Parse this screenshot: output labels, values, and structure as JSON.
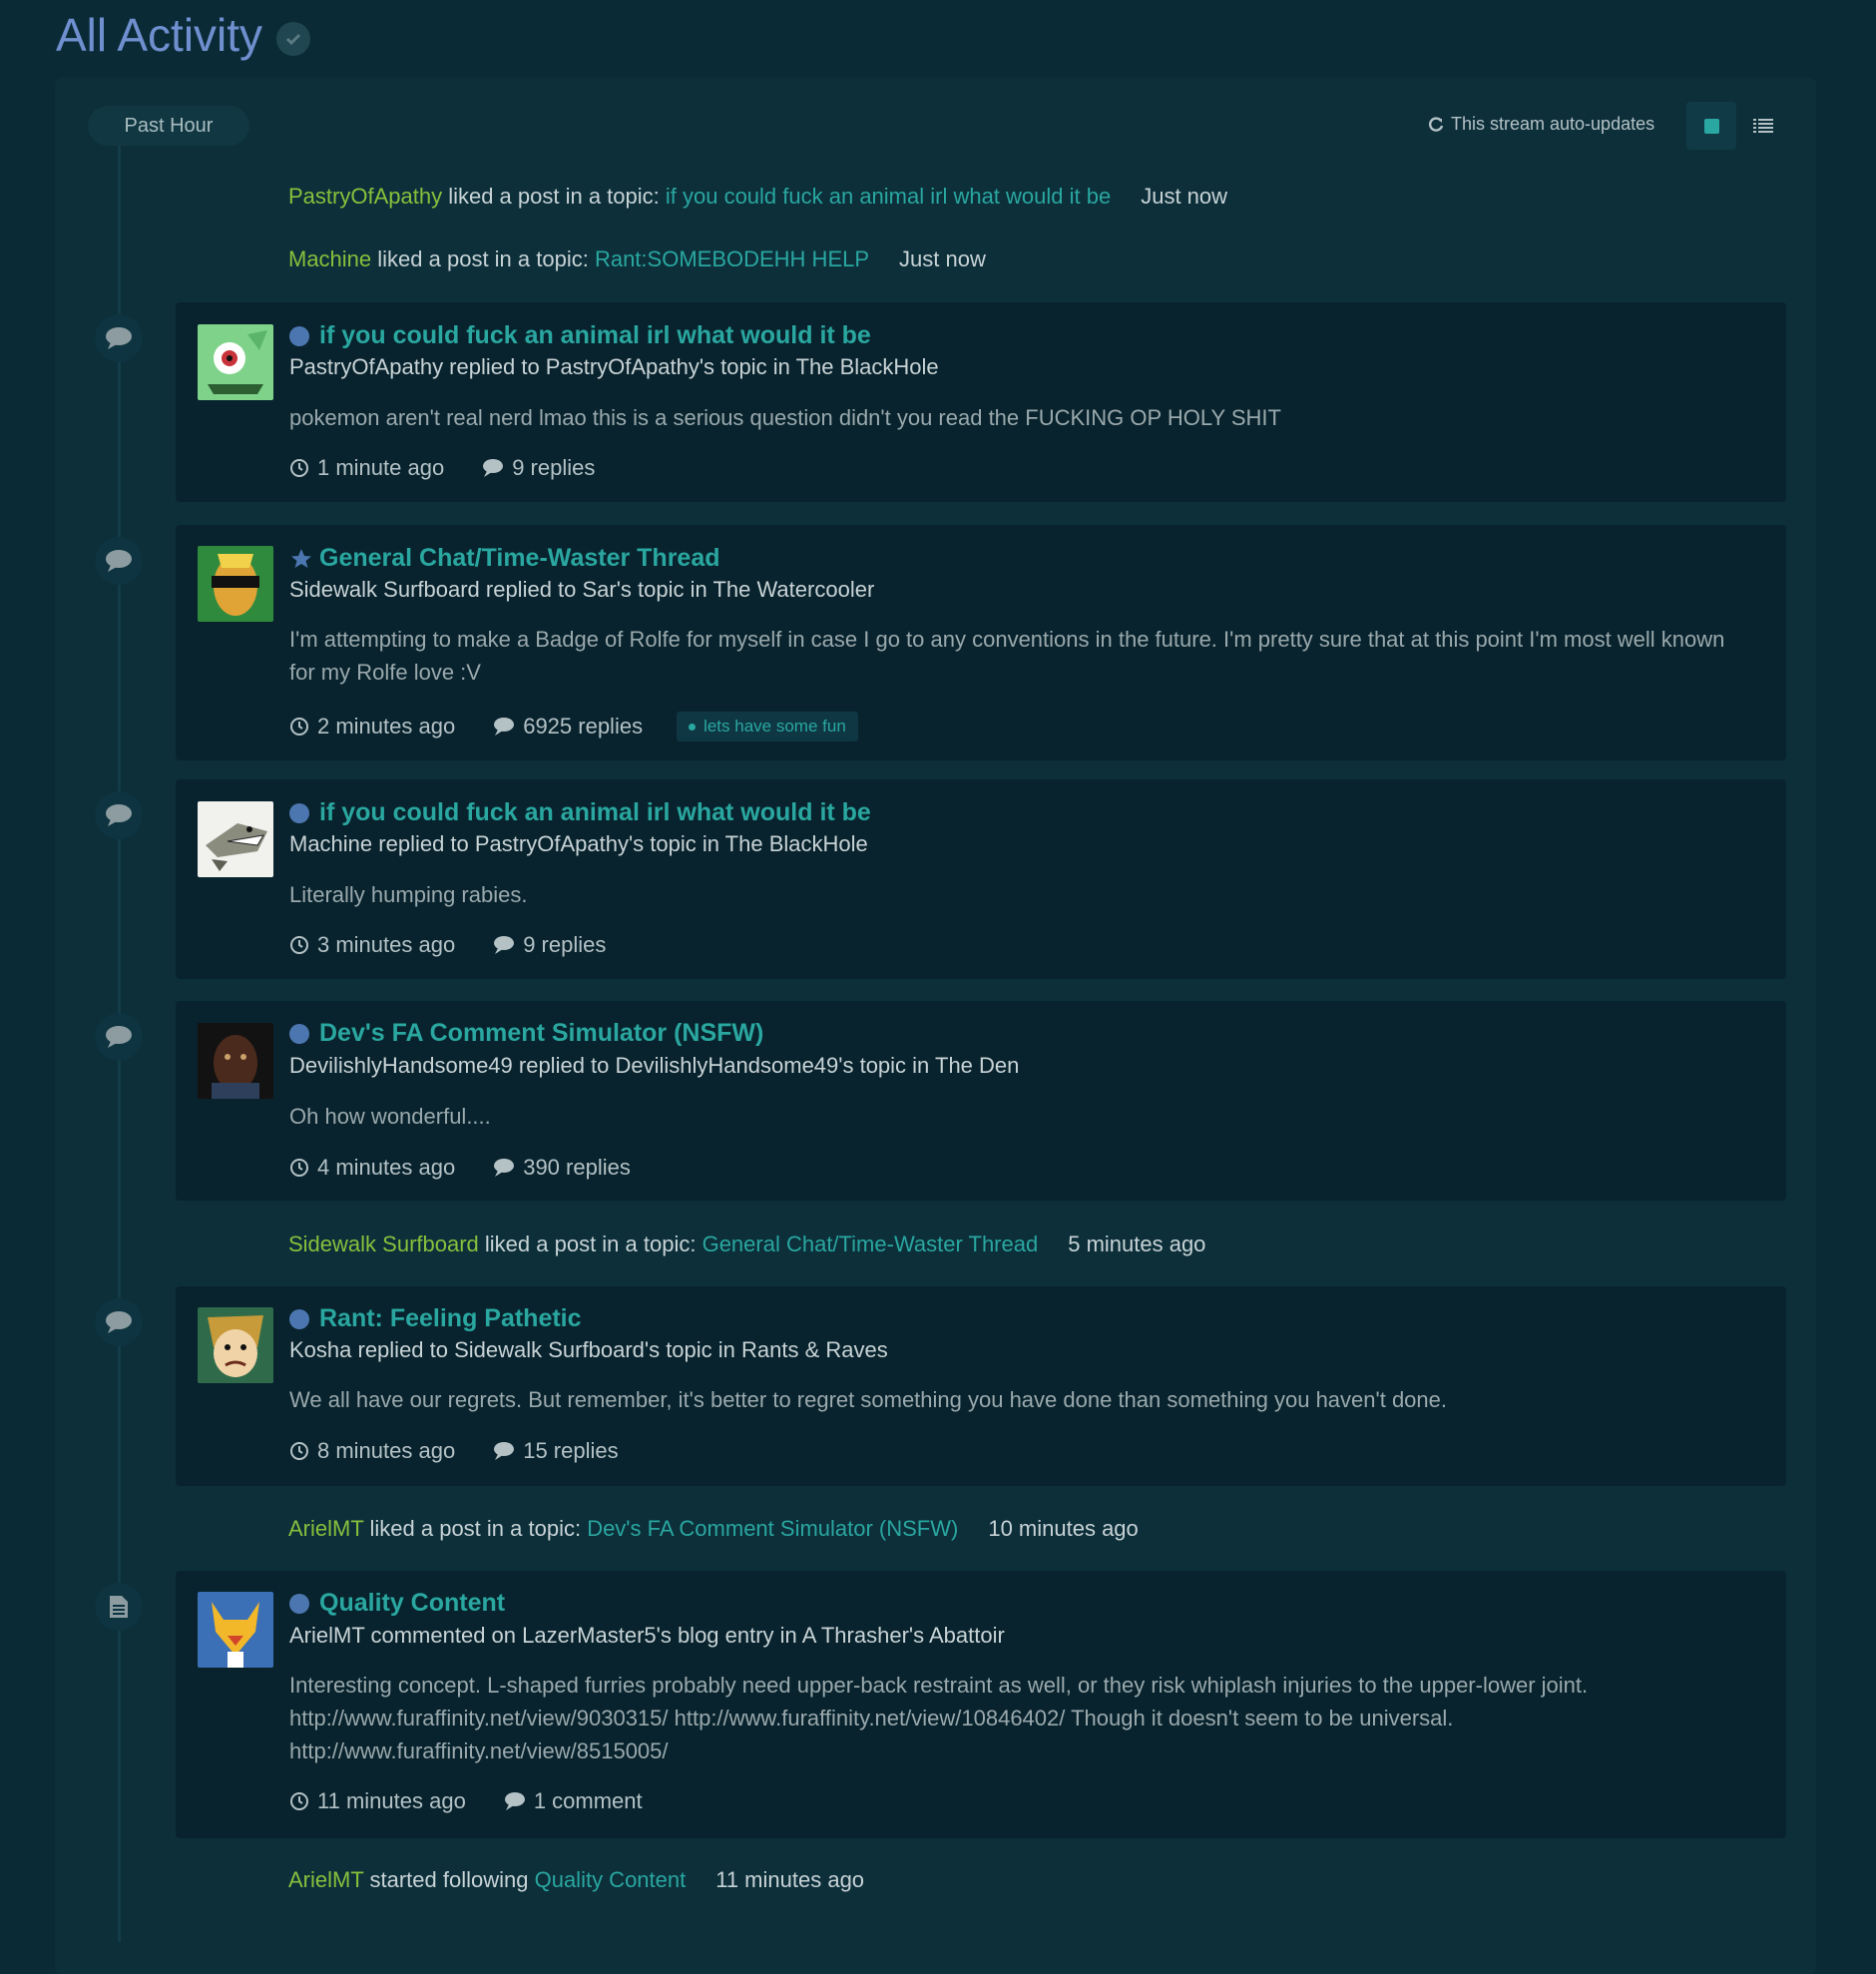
{
  "page": {
    "title": "All Activity"
  },
  "toolbar": {
    "filter_label": "Past Hour",
    "autoupdate_label": "This stream auto-updates",
    "icons": [
      "refresh-icon",
      "expanded-view-icon",
      "condensed-view-icon"
    ]
  },
  "colors": {
    "background": "#0a2b36",
    "accent": "#2aa7a0",
    "username": "#86c13c",
    "title": "#6f8fcf",
    "unread_dot": "#4c76b0"
  },
  "activity": {
    "like1": {
      "user": "PastryOfApathy",
      "action": " liked a post in a topic: ",
      "topic": "if you could fuck an animal irl what would it be",
      "time": "Just now"
    },
    "like2": {
      "user": "Machine",
      "action": " liked a post in a topic: ",
      "topic": "Rant:SOMEBODEHH HELP",
      "time": "Just now"
    },
    "item1": {
      "title": "if you could fuck an animal irl what would it be",
      "subtitle": "PastryOfApathy replied to PastryOfApathy's topic in The BlackHole",
      "snippet": "pokemon aren't real nerd lmao this is a serious question didn't you read the FUCKING OP HOLY SHIT",
      "time": "1 minute ago",
      "replies": "9 replies"
    },
    "item2": {
      "title": "General Chat/Time-Waster Thread",
      "subtitle": "Sidewalk Surfboard replied to Sar's topic in The Watercooler",
      "snippet": "I'm attempting to make a Badge of Rolfe for myself in case I go to any conventions in the future. I'm pretty sure that at this point I'm most well known for my Rolfe love :V",
      "time": "2 minutes ago",
      "replies": "6925 replies",
      "tag": "lets have some fun"
    },
    "item3": {
      "title": "if you could fuck an animal irl what would it be",
      "subtitle": "Machine replied to PastryOfApathy's topic in The BlackHole",
      "snippet": "Literally humping rabies.",
      "time": "3 minutes ago",
      "replies": "9 replies"
    },
    "item4": {
      "title": "Dev's FA Comment Simulator (NSFW)",
      "subtitle": "DevilishlyHandsome49 replied to DevilishlyHandsome49's topic in The Den",
      "snippet": "Oh how wonderful....",
      "time": "4 minutes ago",
      "replies": "390 replies"
    },
    "like3": {
      "user": "Sidewalk Surfboard",
      "action": " liked a post in a topic: ",
      "topic": "General Chat/Time-Waster Thread",
      "time": "5 minutes ago"
    },
    "item5": {
      "title": "Rant: Feeling Pathetic",
      "subtitle": "Kosha replied to Sidewalk Surfboard's topic in Rants & Raves",
      "snippet": "We all have our regrets. But remember, it's better to regret something you have done than something you haven't done.",
      "time": "8 minutes ago",
      "replies": "15 replies"
    },
    "like4": {
      "user": "ArielMT",
      "action": " liked a post in a topic: ",
      "topic": "Dev's FA Comment Simulator (NSFW)",
      "time": "10 minutes ago"
    },
    "item6": {
      "title": "Quality Content",
      "subtitle": "ArielMT commented on LazerMaster5's blog entry in A Thrasher's Abattoir",
      "snippet": "Interesting concept. L-shaped furries probably need upper-back restraint as well, or they risk whiplash injuries to the upper-lower joint. http://www.furaffinity.net/view/9030315/ http://www.furaffinity.net/view/10846402/ Though it doesn't seem to be universal. http://www.furaffinity.net/view/8515005/",
      "time": "11 minutes ago",
      "replies": "1 comment"
    },
    "follow1": {
      "user": "ArielMT",
      "action": " started following ",
      "topic": "Quality Content",
      "time": "11 minutes ago"
    }
  }
}
